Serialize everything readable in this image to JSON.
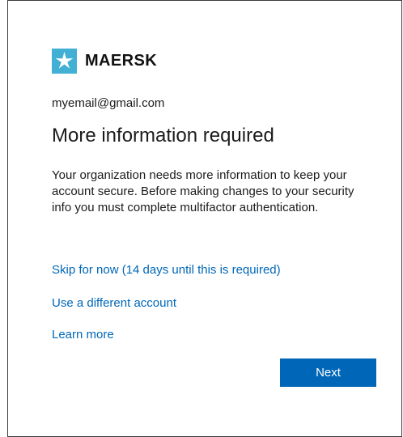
{
  "brand": {
    "name": "MAERSK",
    "icon": "star-icon",
    "color": "#42b0d5"
  },
  "account": {
    "email": "myemail@gmail.com"
  },
  "page": {
    "title": "More information required",
    "description": "Your organization needs more information to keep your account secure. Before making changes to your security info you must complete multifactor authentication."
  },
  "links": {
    "skip": "Skip for now (14 days until this is required)",
    "different_account": "Use a different account",
    "learn_more": "Learn more",
    "color": "#0067b8"
  },
  "actions": {
    "next_label": "Next",
    "button_color": "#0067b8"
  }
}
